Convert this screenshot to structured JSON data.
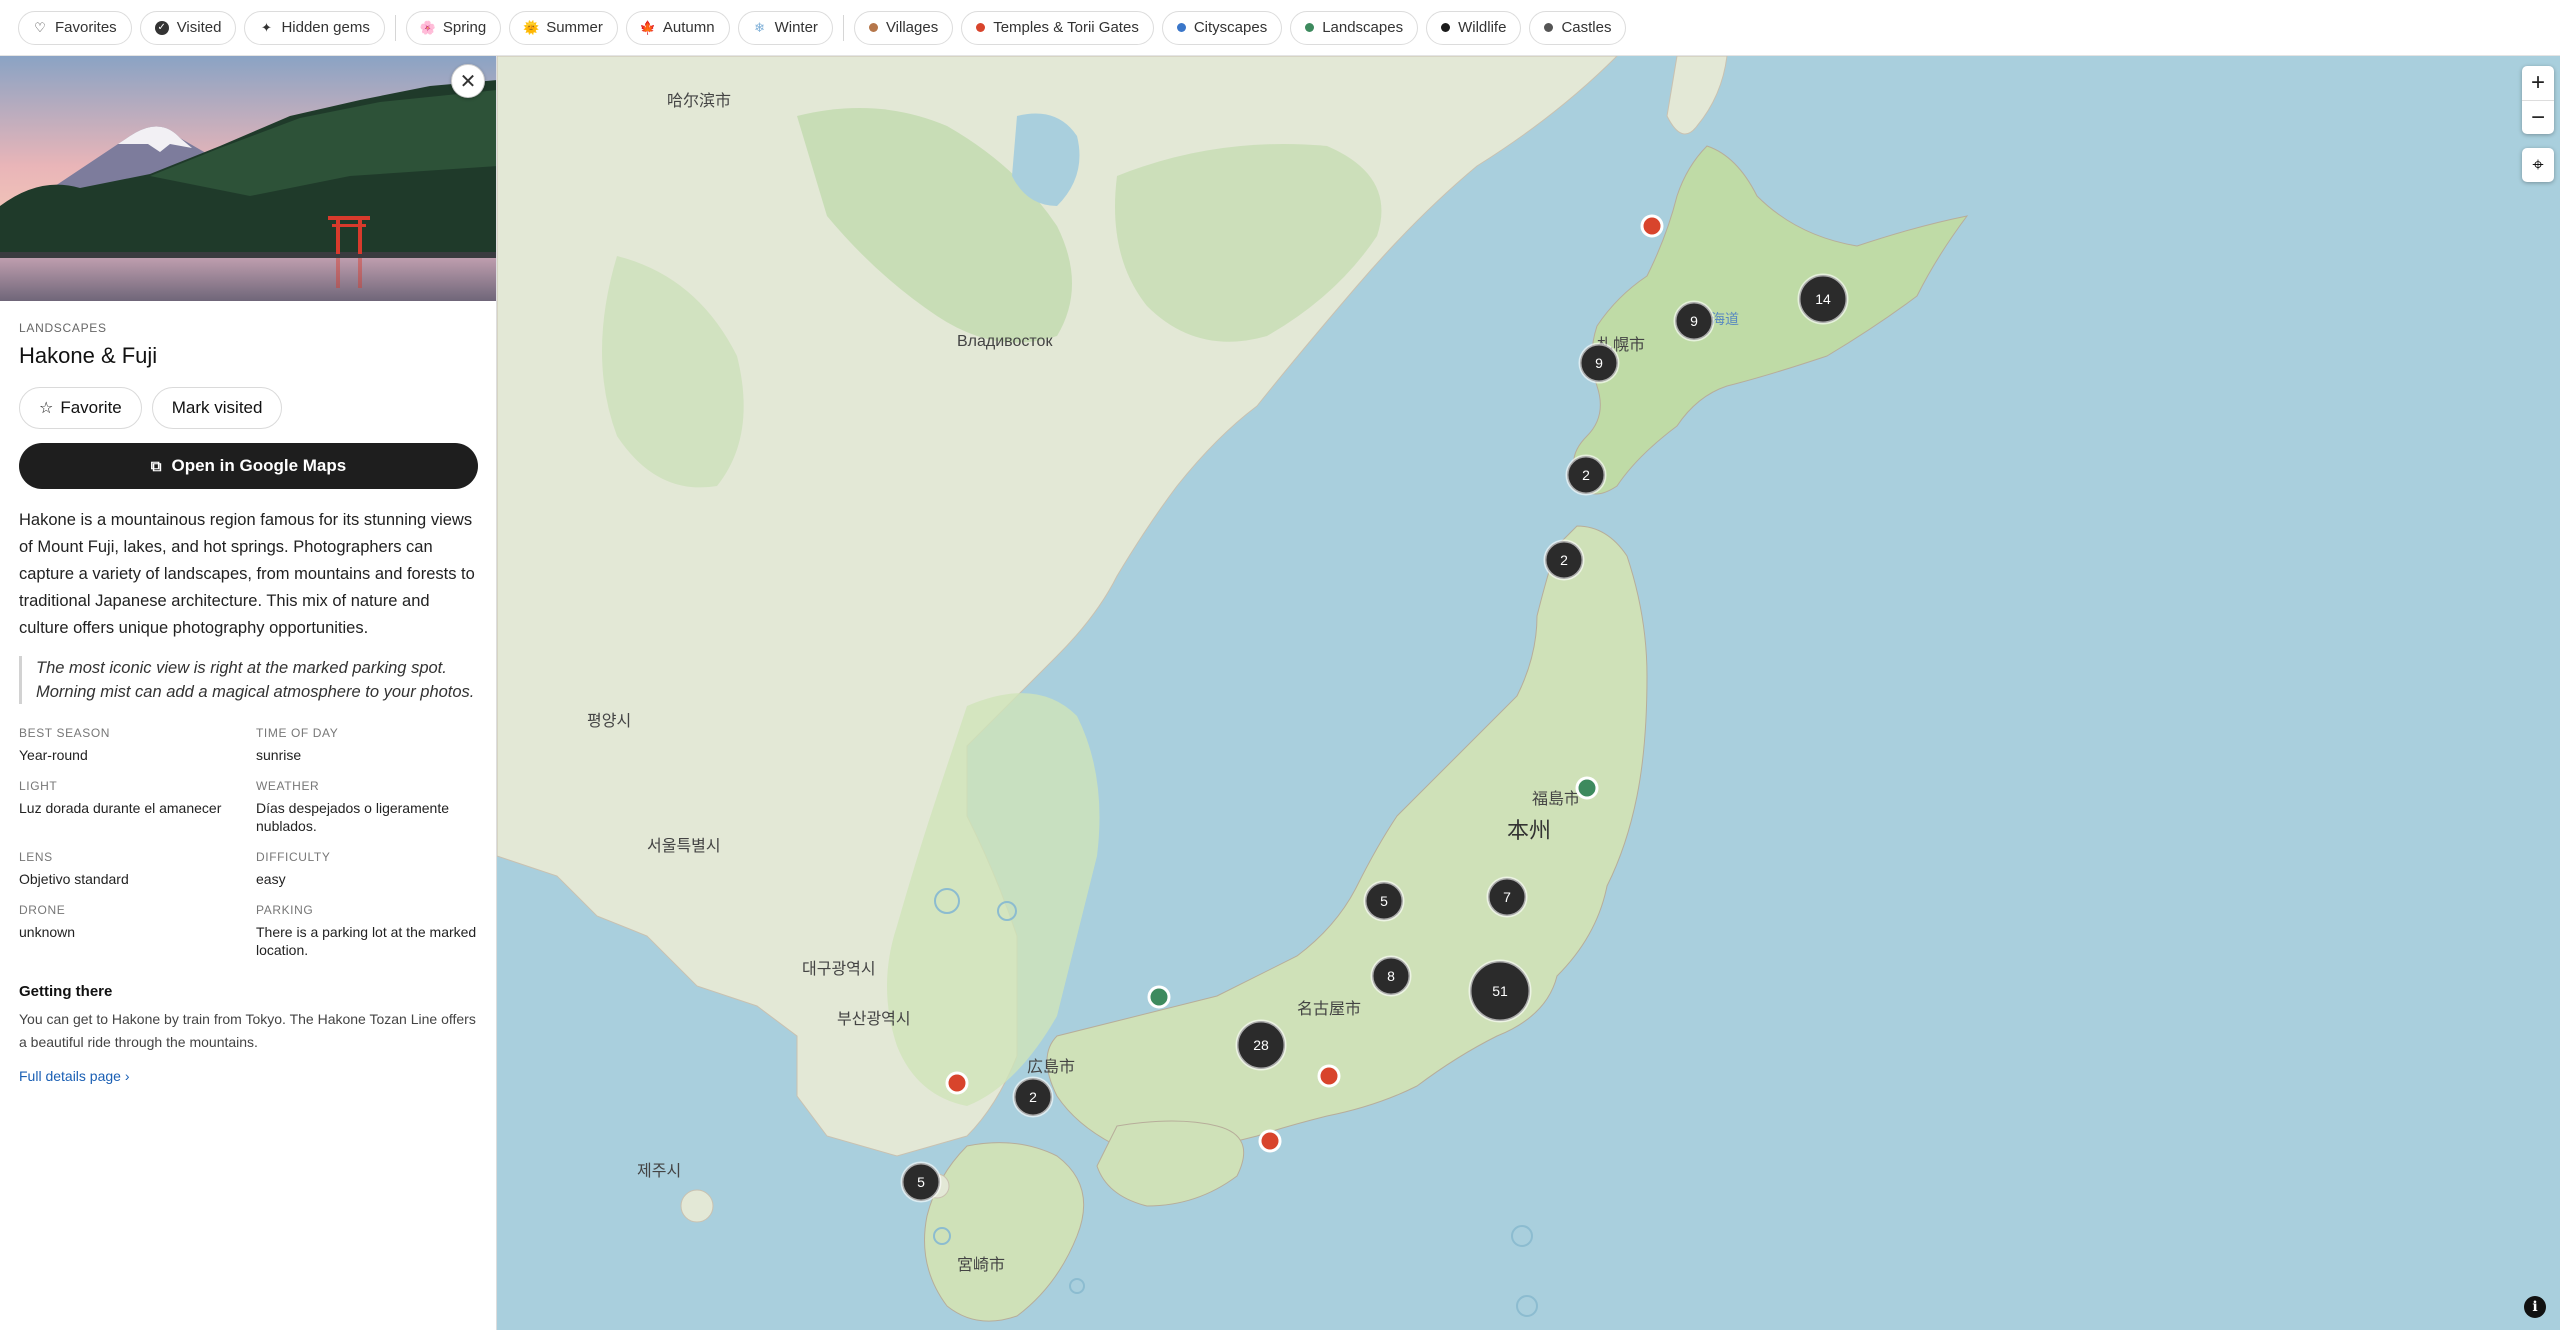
{
  "filters": {
    "favorites": "Favorites",
    "visited": "Visited",
    "hidden_gems": "Hidden gems",
    "seasons": [
      {
        "label": "Spring",
        "icon": "🌸"
      },
      {
        "label": "Summer",
        "icon": "🌞"
      },
      {
        "label": "Autumn",
        "icon": "🍁"
      },
      {
        "label": "Winter",
        "icon": "❄"
      }
    ],
    "categories": [
      {
        "label": "Villages",
        "color": "#b5764a"
      },
      {
        "label": "Temples & Torii Gates",
        "color": "#d8442c"
      },
      {
        "label": "Cityscapes",
        "color": "#3a76c9"
      },
      {
        "label": "Landscapes",
        "color": "#3d8a5e"
      },
      {
        "label": "Wildlife",
        "color": "#1b1b1b"
      },
      {
        "label": "Castles",
        "color": "#555555"
      }
    ]
  },
  "spot": {
    "category": "LANDSCAPES",
    "title": "Hakone & Fuji",
    "favorite_label": "Favorite",
    "visited_label": "Mark visited",
    "gmaps_label": "Open in Google Maps",
    "description": "Hakone is a mountainous region famous for its stunning views of Mount Fuji, lakes, and hot springs. Photographers can capture a variety of landscapes, from mountains and forests to traditional Japanese architecture. This mix of nature and culture offers unique photography opportunities.",
    "tip": "The most iconic view is right at the marked parking spot. Morning mist can add a magical atmosphere to your photos.",
    "facts": [
      {
        "key": "BEST SEASON",
        "value": "Year-round"
      },
      {
        "key": "TIME OF DAY",
        "value": "sunrise"
      },
      {
        "key": "LIGHT",
        "value": "Luz dorada durante el amanecer"
      },
      {
        "key": "WEATHER",
        "value": "Días despejados o ligeramente nublados."
      },
      {
        "key": "LENS",
        "value": "Objetivo standard"
      },
      {
        "key": "DIFFICULTY",
        "value": "easy"
      },
      {
        "key": "DRONE",
        "value": "unknown"
      },
      {
        "key": "PARKING",
        "value": "There is a parking lot at the marked location."
      }
    ],
    "getting_there_title": "Getting there",
    "getting_there_text": "You can get to Hakone by train from Tokyo. The Hakone Tozan Line offers a beautiful ride through the mountains.",
    "full_details": "Full details page ›"
  },
  "map": {
    "clusters": [
      "14",
      "9",
      "9",
      "2",
      "2",
      "5",
      "7",
      "8",
      "51",
      "28",
      "2",
      "5"
    ],
    "labels": {
      "honshu": "本州",
      "hokkaido": "北海道",
      "vladivostok": "Владивосток",
      "sapporo": "札幌市",
      "fukushima": "福島市",
      "nagoya": "名古屋市",
      "hiroshima": "広島市",
      "seoul": "서울특별시",
      "daegu": "대구광역시",
      "busan": "부산광역시",
      "kagoshima": "宮崎市",
      "jeju": "제주시",
      "pyongyang": "평양시",
      "harbin": "哈尔滨市"
    }
  }
}
